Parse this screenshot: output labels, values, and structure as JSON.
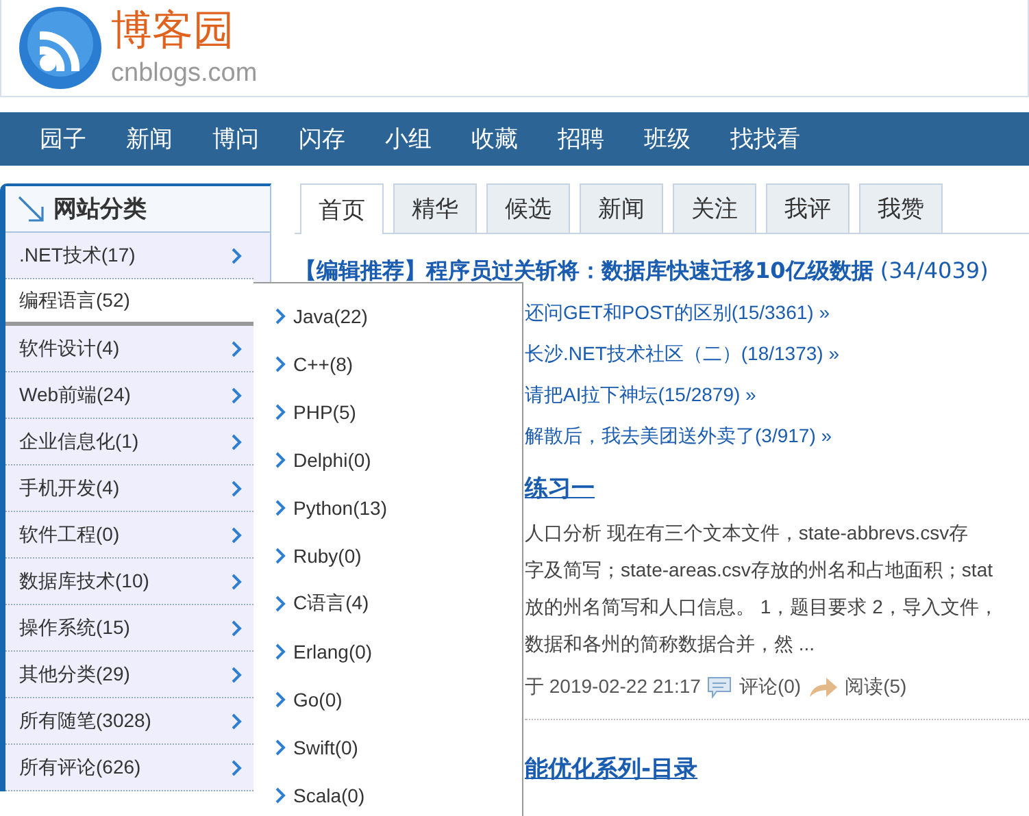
{
  "logo": {
    "title": "博客园",
    "domain": "cnblogs.com"
  },
  "nav": [
    "园子",
    "新闻",
    "博问",
    "闪存",
    "小组",
    "收藏",
    "招聘",
    "班级",
    "找找看"
  ],
  "sidebar": {
    "title": "网站分类",
    "items": [
      {
        "label": ".NET技术(17)",
        "selected": false
      },
      {
        "label": "编程语言(52)",
        "selected": true
      },
      {
        "label": "软件设计(4)",
        "selected": false
      },
      {
        "label": "Web前端(24)",
        "selected": false
      },
      {
        "label": "企业信息化(1)",
        "selected": false
      },
      {
        "label": "手机开发(4)",
        "selected": false
      },
      {
        "label": "软件工程(0)",
        "selected": false
      },
      {
        "label": "数据库技术(10)",
        "selected": false
      },
      {
        "label": "操作系统(15)",
        "selected": false
      },
      {
        "label": "其他分类(29)",
        "selected": false
      },
      {
        "label": "所有随笔(3028)",
        "selected": false
      },
      {
        "label": "所有评论(626)",
        "selected": false
      }
    ]
  },
  "submenu": [
    "Java(22)",
    "C++(8)",
    "PHP(5)",
    "Delphi(0)",
    "Python(13)",
    "Ruby(0)",
    "C语言(4)",
    "Erlang(0)",
    "Go(0)",
    "Swift(0)",
    "Scala(0)"
  ],
  "tabs": [
    {
      "label": "首页",
      "selected": true
    },
    {
      "label": "精华",
      "selected": false
    },
    {
      "label": "候选",
      "selected": false
    },
    {
      "label": "新闻",
      "selected": false
    },
    {
      "label": "关注",
      "selected": false
    },
    {
      "label": "我评",
      "selected": false
    },
    {
      "label": "我赞",
      "selected": false
    }
  ],
  "headline": "**【编辑推荐】程序员过关斩将：数据库快速迁移10亿级数据** (34/4039)",
  "links": [
    "还问GET和POST的区别(15/3361) »",
    "长沙.NET技术社区（二）(18/1373) »",
    "请把AI拉下神坛(15/2879) »",
    "解散后，我去美团送外卖了(3/917) »"
  ],
  "posts": [
    {
      "title": "练习一",
      "summary": [
        "人口分析 现在有三个文本文件，state-abbrevs.csv存",
        "字及简写；state-areas.csv存放的州名和占地面积；stat",
        "放的州名简写和人口信息。 1，题目要求 2，导入文件，",
        "数据和各州的简称数据合并，然 ..."
      ],
      "date": "于 2019-02-22 21:17",
      "comments": "评论(0)",
      "reads": "阅读(5)"
    },
    {
      "title": "能优化系列-目录"
    }
  ]
}
